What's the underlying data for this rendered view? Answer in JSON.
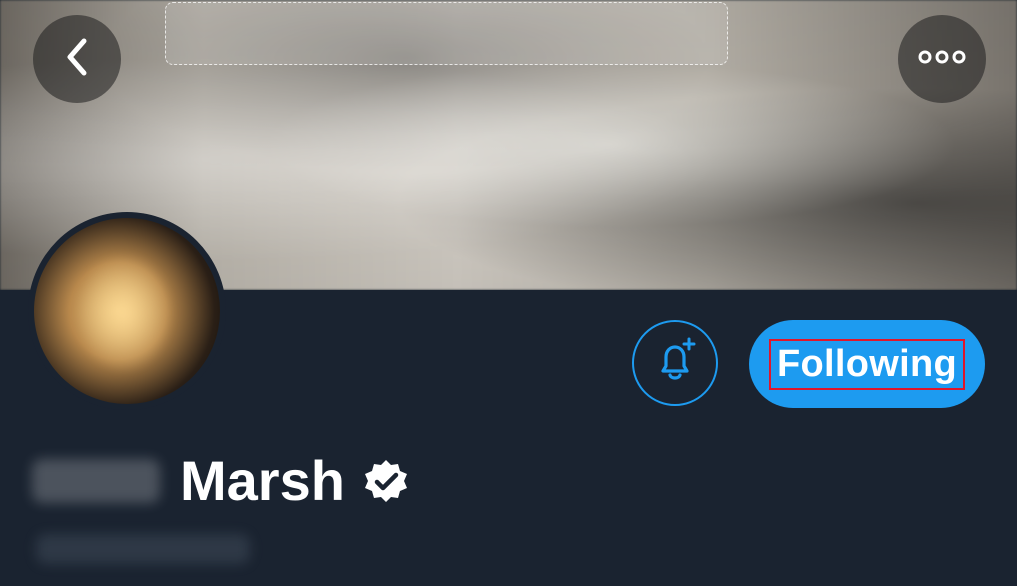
{
  "header": {
    "back_icon": "chevron-left-icon",
    "more_icon": "more-horizontal-icon"
  },
  "profile": {
    "name_visible": "Marsh",
    "follow_button_label": "Following",
    "notifications_icon": "bell-plus-icon",
    "verified_icon": "verified-badge-icon"
  },
  "colors": {
    "accent": "#1d9bf0",
    "background": "#15202b",
    "highlight_outline": "#e0162b"
  }
}
